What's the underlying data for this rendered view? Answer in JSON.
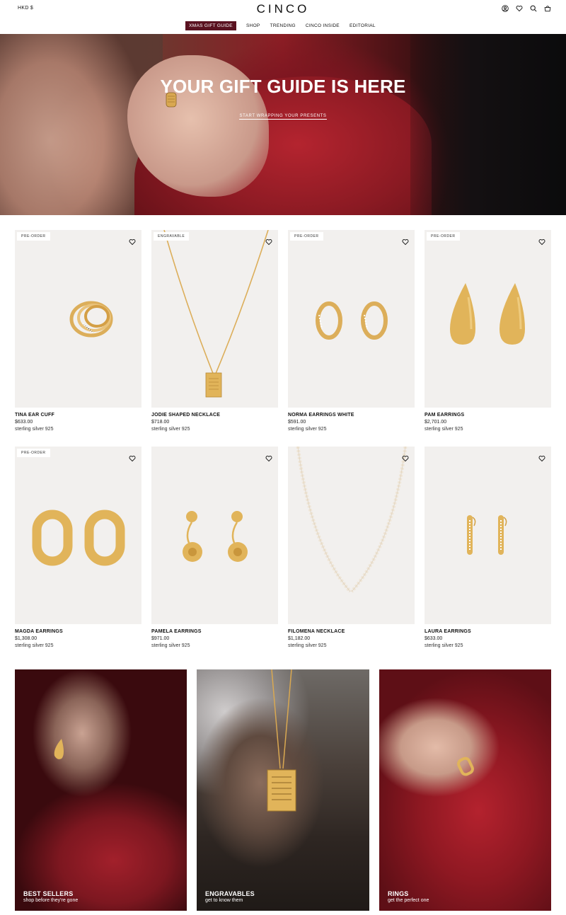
{
  "header": {
    "currency": "HKD $",
    "logo": "CINCO",
    "icons": [
      "account-icon",
      "wishlist-icon",
      "search-icon",
      "cart-icon"
    ]
  },
  "nav": {
    "items": [
      "XMAS GIFT GUIDE",
      "SHOP",
      "TRENDING",
      "CINCO INSIDE",
      "EDITORIAL"
    ],
    "active_color": "#5a1220"
  },
  "hero": {
    "title": "YOUR GIFT GUIDE IS HERE",
    "link": "START WRAPPING YOUR PRESENTS"
  },
  "products": [
    {
      "name": "TINA EAR CUFF",
      "price": "$633.00",
      "material": "sterling silver 925",
      "badge": "PRE-ORDER"
    },
    {
      "name": "JODIE SHAPED NECKLACE",
      "price": "$718.00",
      "material": "sterling silver 925",
      "badge": "ENGRAVABLE"
    },
    {
      "name": "NORMA EARRINGS WHITE",
      "price": "$591.00",
      "material": "sterling silver 925",
      "badge": "PRE-ORDER"
    },
    {
      "name": "PAM EARRINGS",
      "price": "$2,701.00",
      "material": "sterling silver 925",
      "badge": "PRE-ORDER"
    },
    {
      "name": "MAGDA EARRINGS",
      "price": "$1,308.00",
      "material": "sterling silver 925",
      "badge": "PRE-ORDER"
    },
    {
      "name": "PAMELA EARRINGS",
      "price": "$971.00",
      "material": "sterling silver 925",
      "badge": ""
    },
    {
      "name": "FILOMENA NECKLACE",
      "price": "$1,182.00",
      "material": "sterling silver 925",
      "badge": ""
    },
    {
      "name": "LAURA EARRINGS",
      "price": "$633.00",
      "material": "sterling silver 925",
      "badge": ""
    }
  ],
  "collections": [
    {
      "title": "BEST SELLERS",
      "subtitle": "shop before they're gone"
    },
    {
      "title": "ENGRAVABLES",
      "subtitle": "get to know them"
    },
    {
      "title": "RINGS",
      "subtitle": "get the perfect one"
    }
  ],
  "colors": {
    "gold": "#e1b45a",
    "card_bg": "#f2f0ee",
    "velvet_red": "#8b1a23"
  }
}
